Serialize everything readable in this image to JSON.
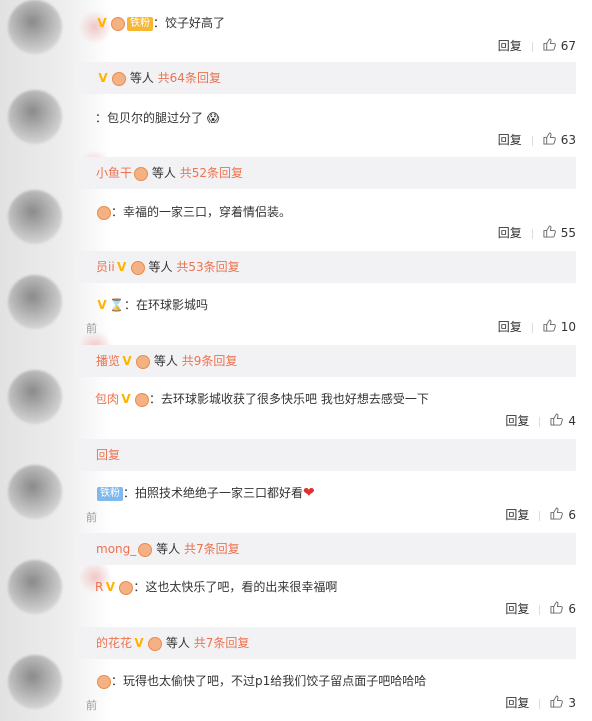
{
  "comments": [
    {
      "name": "",
      "badge": "铁粉",
      "text": "：饺子好高了",
      "reply_label": "回复",
      "likes": "67"
    },
    {
      "name": "",
      "text": "：包贝尔的腿过分了",
      "reply_label": "回复",
      "likes": "63"
    },
    {
      "name": "",
      "text": "：幸福的一家三口，穿着情侣装。",
      "reply_label": "回复",
      "likes": "55"
    },
    {
      "name": "",
      "text": "：在环球影城吗",
      "reply_label": "回复",
      "likes": "10",
      "time": "前"
    },
    {
      "name": "包肉",
      "text": "：去环球影城收获了很多快乐吧 我也好想去感受一下",
      "reply_label": "回复",
      "likes": "4"
    },
    {
      "name": "",
      "badge": "铁粉",
      "text": "：拍照技术绝绝子一家三口都好看",
      "reply_label": "回复",
      "likes": "6",
      "time": "前"
    },
    {
      "name": "R",
      "text": "：这也太快乐了吧，看的出来很幸福啊",
      "reply_label": "回复",
      "likes": "6"
    },
    {
      "name": "",
      "text": "：玩得也太偷快了吧，不过p1给我们饺子留点面子吧哈哈哈",
      "reply_label": "回复",
      "likes": "3",
      "time": "前"
    }
  ],
  "sub_threads": [
    {
      "name": "",
      "tail": "等人",
      "count": "共64条回复"
    },
    {
      "name": "小鱼干",
      "tail": "等人",
      "count": "共52条回复"
    },
    {
      "name": "员ii",
      "tail": "等人",
      "count": "共53条回复"
    },
    {
      "name": "播览",
      "tail": "等人",
      "count": "共9条回复"
    },
    {
      "name": "",
      "tail": "",
      "count": "回复"
    },
    {
      "name": "mong_",
      "tail": "等人",
      "count": "共7条回复"
    },
    {
      "name": "的花花",
      "tail": "等人",
      "count": "共7条回复"
    }
  ],
  "icons": {
    "vip": "vip-v-icon",
    "like": "thumbs-up-icon",
    "medal": "medal-icon",
    "heart": "heart-icon"
  }
}
